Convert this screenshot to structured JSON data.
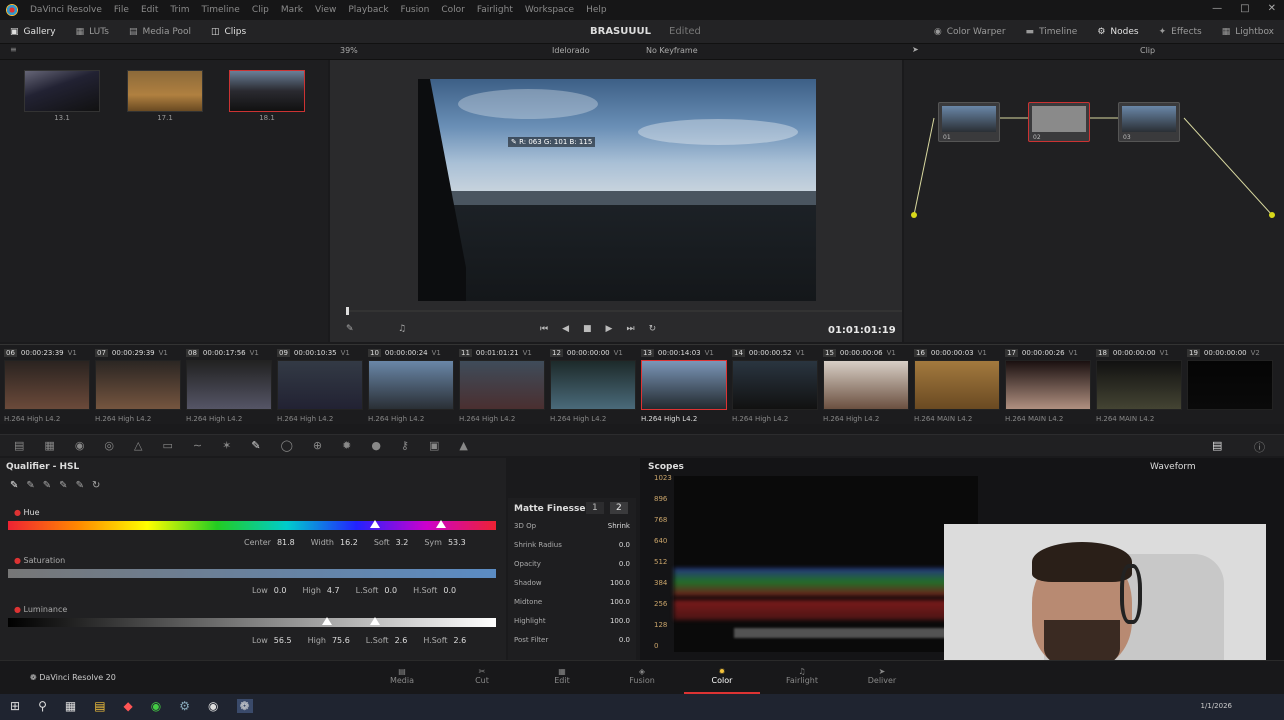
{
  "menubar": {
    "app_title": "DaVinci Resolve",
    "items": [
      "File",
      "Edit",
      "Trim",
      "Timeline",
      "Clip",
      "Mark",
      "View",
      "Playback",
      "Fusion",
      "Color",
      "Fairlight",
      "Workspace",
      "Help"
    ]
  },
  "toolbar": {
    "gallery": "Gallery",
    "luts": "LUTs",
    "media_pool": "Media Pool",
    "clips": "Clips",
    "project_name": "BRASUUUL",
    "project_status": "Edited",
    "color_warper": "Color Warper",
    "timeline": "Timeline",
    "nodes": "Nodes",
    "effects": "Effects",
    "lightbox": "Lightbox"
  },
  "subbar": {
    "zoom": "39%",
    "grade_name": "Idelorado",
    "keyframe": "No Keyframe",
    "clip_mode": "Clip"
  },
  "gallery": {
    "stills": [
      {
        "label": "13.1"
      },
      {
        "label": "17.1"
      },
      {
        "label": "18.1"
      }
    ]
  },
  "viewer": {
    "picker_readout": "R: 063 G: 101 B: 115",
    "timecode": "01:01:01:19"
  },
  "nodes": [
    {
      "label": "01"
    },
    {
      "label": "02"
    },
    {
      "label": "03"
    }
  ],
  "timeline": {
    "clips": [
      {
        "num": "06",
        "tc": "00:00:23:39",
        "track": "V1",
        "codec": "H.264 High L4.2",
        "c1": "#2a2320",
        "c2": "#6b4a3a"
      },
      {
        "num": "07",
        "tc": "00:00:29:39",
        "track": "V1",
        "codec": "H.264 High L4.2",
        "c1": "#2b2623",
        "c2": "#75553f"
      },
      {
        "num": "08",
        "tc": "00:00:17:56",
        "track": "V1",
        "codec": "H.264 High L4.2",
        "c1": "#222",
        "c2": "#556"
      },
      {
        "num": "09",
        "tc": "00:00:10:35",
        "track": "V1",
        "codec": "H.264 High L4.2",
        "c1": "#333a45",
        "c2": "#223"
      },
      {
        "num": "10",
        "tc": "00:00:00:24",
        "track": "V1",
        "codec": "H.264 High L4.2",
        "c1": "#6a87a8",
        "c2": "#2a2f35"
      },
      {
        "num": "11",
        "tc": "00:01:01:21",
        "track": "V1",
        "codec": "H.264 High L4.2",
        "c1": "#3f4c5a",
        "c2": "#4a2f30"
      },
      {
        "num": "12",
        "tc": "00:00:00:00",
        "track": "V1",
        "codec": "H.264 High L4.2",
        "c1": "#1d2a2a",
        "c2": "#4a6a7a"
      },
      {
        "num": "13",
        "tc": "00:00:14:03",
        "track": "V1",
        "codec": "H.264 High L4.2",
        "c1": "#7b96b8",
        "c2": "#232a2f"
      },
      {
        "num": "14",
        "tc": "00:00:00:52",
        "track": "V1",
        "codec": "H.264 High L4.2",
        "c1": "#2a3540",
        "c2": "#111"
      },
      {
        "num": "15",
        "tc": "00:00:00:06",
        "track": "V1",
        "codec": "H.264 High L4.2",
        "c1": "#d8cfc6",
        "c2": "#6b5040"
      },
      {
        "num": "16",
        "tc": "00:00:00:03",
        "track": "V1",
        "codec": "H.264 MAIN L4.2",
        "c1": "#a37a3e",
        "c2": "#6a4a22"
      },
      {
        "num": "17",
        "tc": "00:00:00:26",
        "track": "V1",
        "codec": "H.264 MAIN L4.2",
        "c1": "#1a1010",
        "c2": "#b09080"
      },
      {
        "num": "18",
        "tc": "00:00:00:00",
        "track": "V1",
        "codec": "H.264 MAIN L4.2",
        "c1": "#111",
        "c2": "#443"
      },
      {
        "num": "19",
        "tc": "00:00:00:00",
        "track": "V2",
        "codec": "",
        "c1": "#050505",
        "c2": "#0a0a0a"
      }
    ]
  },
  "qualifier": {
    "title": "Qualifier - HSL",
    "hue_label": "Hue",
    "hue_center_label": "Center",
    "hue_center": "81.8",
    "hue_width_label": "Width",
    "hue_width": "16.2",
    "hue_soft_label": "Soft",
    "hue_soft": "3.2",
    "hue_sym_label": "Sym",
    "hue_sym": "53.3",
    "sat_label": "Saturation",
    "sat_low_label": "Low",
    "sat_low": "0.0",
    "sat_high_label": "High",
    "sat_high": "4.7",
    "sat_lsoft_label": "L.Soft",
    "sat_lsoft": "0.0",
    "sat_hsoft_label": "H.Soft",
    "sat_hsoft": "0.0",
    "lum_label": "Luminance",
    "lum_low_label": "Low",
    "lum_low": "56.5",
    "lum_high_label": "High",
    "lum_high": "75.6",
    "lum_lsoft_label": "L.Soft",
    "lum_lsoft": "2.6",
    "lum_hsoft_label": "H.Soft",
    "lum_hsoft": "2.6"
  },
  "matte": {
    "title": "Matte Finesse",
    "tab1": "1",
    "tab2": "2",
    "rows": [
      {
        "label": "3D Op",
        "value": "Shrink"
      },
      {
        "label": "Shrink Radius",
        "value": "0.0"
      },
      {
        "label": "Opacity",
        "value": "0.0"
      },
      {
        "label": "Shadow",
        "value": "100.0"
      },
      {
        "label": "Midtone",
        "value": "100.0"
      },
      {
        "label": "Highlight",
        "value": "100.0"
      },
      {
        "label": "Post Filter",
        "value": "0.0"
      }
    ]
  },
  "scopes": {
    "title": "Scopes",
    "mode": "Waveform",
    "scale": [
      "1023",
      "896",
      "768",
      "640",
      "512",
      "384",
      "256",
      "128",
      "0"
    ]
  },
  "bottomnav": {
    "brand": "DaVinci Resolve 20",
    "pages": [
      "Media",
      "Cut",
      "Edit",
      "Fusion",
      "Color",
      "Fairlight",
      "Deliver"
    ],
    "active": "Color"
  },
  "taskbar": {
    "clock": "1/1/2026"
  }
}
